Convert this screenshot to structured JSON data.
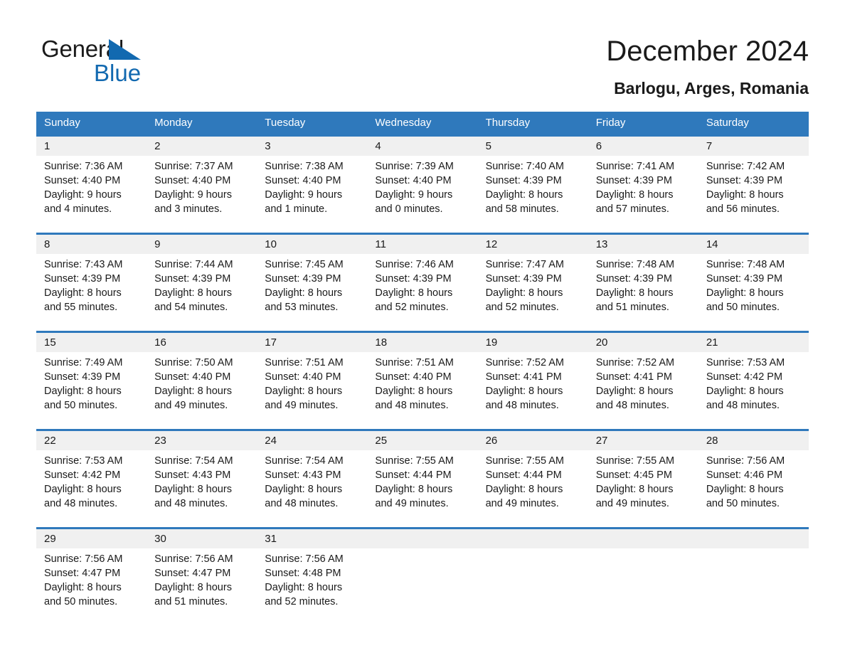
{
  "brand": {
    "word_one": "General",
    "word_two": "Blue",
    "triangle_color": "#1269b0",
    "text_color": "#1b1b1b"
  },
  "header": {
    "title": "December 2024",
    "subtitle": "Barlogu, Arges, Romania"
  },
  "theme": {
    "header_blue": "#2f79bc",
    "week_rule_blue": "#2f79bc",
    "date_band_gray": "#f0f0f0",
    "text": "#1a1a1a"
  },
  "weekdays": [
    "Sunday",
    "Monday",
    "Tuesday",
    "Wednesday",
    "Thursday",
    "Friday",
    "Saturday"
  ],
  "weeks": [
    {
      "days": [
        {
          "date": "1",
          "lines": [
            "Sunrise: 7:36 AM",
            "Sunset: 4:40 PM",
            "Daylight: 9 hours",
            "and 4 minutes."
          ]
        },
        {
          "date": "2",
          "lines": [
            "Sunrise: 7:37 AM",
            "Sunset: 4:40 PM",
            "Daylight: 9 hours",
            "and 3 minutes."
          ]
        },
        {
          "date": "3",
          "lines": [
            "Sunrise: 7:38 AM",
            "Sunset: 4:40 PM",
            "Daylight: 9 hours",
            "and 1 minute."
          ]
        },
        {
          "date": "4",
          "lines": [
            "Sunrise: 7:39 AM",
            "Sunset: 4:40 PM",
            "Daylight: 9 hours",
            "and 0 minutes."
          ]
        },
        {
          "date": "5",
          "lines": [
            "Sunrise: 7:40 AM",
            "Sunset: 4:39 PM",
            "Daylight: 8 hours",
            "and 58 minutes."
          ]
        },
        {
          "date": "6",
          "lines": [
            "Sunrise: 7:41 AM",
            "Sunset: 4:39 PM",
            "Daylight: 8 hours",
            "and 57 minutes."
          ]
        },
        {
          "date": "7",
          "lines": [
            "Sunrise: 7:42 AM",
            "Sunset: 4:39 PM",
            "Daylight: 8 hours",
            "and 56 minutes."
          ]
        }
      ]
    },
    {
      "days": [
        {
          "date": "8",
          "lines": [
            "Sunrise: 7:43 AM",
            "Sunset: 4:39 PM",
            "Daylight: 8 hours",
            "and 55 minutes."
          ]
        },
        {
          "date": "9",
          "lines": [
            "Sunrise: 7:44 AM",
            "Sunset: 4:39 PM",
            "Daylight: 8 hours",
            "and 54 minutes."
          ]
        },
        {
          "date": "10",
          "lines": [
            "Sunrise: 7:45 AM",
            "Sunset: 4:39 PM",
            "Daylight: 8 hours",
            "and 53 minutes."
          ]
        },
        {
          "date": "11",
          "lines": [
            "Sunrise: 7:46 AM",
            "Sunset: 4:39 PM",
            "Daylight: 8 hours",
            "and 52 minutes."
          ]
        },
        {
          "date": "12",
          "lines": [
            "Sunrise: 7:47 AM",
            "Sunset: 4:39 PM",
            "Daylight: 8 hours",
            "and 52 minutes."
          ]
        },
        {
          "date": "13",
          "lines": [
            "Sunrise: 7:48 AM",
            "Sunset: 4:39 PM",
            "Daylight: 8 hours",
            "and 51 minutes."
          ]
        },
        {
          "date": "14",
          "lines": [
            "Sunrise: 7:48 AM",
            "Sunset: 4:39 PM",
            "Daylight: 8 hours",
            "and 50 minutes."
          ]
        }
      ]
    },
    {
      "days": [
        {
          "date": "15",
          "lines": [
            "Sunrise: 7:49 AM",
            "Sunset: 4:39 PM",
            "Daylight: 8 hours",
            "and 50 minutes."
          ]
        },
        {
          "date": "16",
          "lines": [
            "Sunrise: 7:50 AM",
            "Sunset: 4:40 PM",
            "Daylight: 8 hours",
            "and 49 minutes."
          ]
        },
        {
          "date": "17",
          "lines": [
            "Sunrise: 7:51 AM",
            "Sunset: 4:40 PM",
            "Daylight: 8 hours",
            "and 49 minutes."
          ]
        },
        {
          "date": "18",
          "lines": [
            "Sunrise: 7:51 AM",
            "Sunset: 4:40 PM",
            "Daylight: 8 hours",
            "and 48 minutes."
          ]
        },
        {
          "date": "19",
          "lines": [
            "Sunrise: 7:52 AM",
            "Sunset: 4:41 PM",
            "Daylight: 8 hours",
            "and 48 minutes."
          ]
        },
        {
          "date": "20",
          "lines": [
            "Sunrise: 7:52 AM",
            "Sunset: 4:41 PM",
            "Daylight: 8 hours",
            "and 48 minutes."
          ]
        },
        {
          "date": "21",
          "lines": [
            "Sunrise: 7:53 AM",
            "Sunset: 4:42 PM",
            "Daylight: 8 hours",
            "and 48 minutes."
          ]
        }
      ]
    },
    {
      "days": [
        {
          "date": "22",
          "lines": [
            "Sunrise: 7:53 AM",
            "Sunset: 4:42 PM",
            "Daylight: 8 hours",
            "and 48 minutes."
          ]
        },
        {
          "date": "23",
          "lines": [
            "Sunrise: 7:54 AM",
            "Sunset: 4:43 PM",
            "Daylight: 8 hours",
            "and 48 minutes."
          ]
        },
        {
          "date": "24",
          "lines": [
            "Sunrise: 7:54 AM",
            "Sunset: 4:43 PM",
            "Daylight: 8 hours",
            "and 48 minutes."
          ]
        },
        {
          "date": "25",
          "lines": [
            "Sunrise: 7:55 AM",
            "Sunset: 4:44 PM",
            "Daylight: 8 hours",
            "and 49 minutes."
          ]
        },
        {
          "date": "26",
          "lines": [
            "Sunrise: 7:55 AM",
            "Sunset: 4:44 PM",
            "Daylight: 8 hours",
            "and 49 minutes."
          ]
        },
        {
          "date": "27",
          "lines": [
            "Sunrise: 7:55 AM",
            "Sunset: 4:45 PM",
            "Daylight: 8 hours",
            "and 49 minutes."
          ]
        },
        {
          "date": "28",
          "lines": [
            "Sunrise: 7:56 AM",
            "Sunset: 4:46 PM",
            "Daylight: 8 hours",
            "and 50 minutes."
          ]
        }
      ]
    },
    {
      "days": [
        {
          "date": "29",
          "lines": [
            "Sunrise: 7:56 AM",
            "Sunset: 4:47 PM",
            "Daylight: 8 hours",
            "and 50 minutes."
          ]
        },
        {
          "date": "30",
          "lines": [
            "Sunrise: 7:56 AM",
            "Sunset: 4:47 PM",
            "Daylight: 8 hours",
            "and 51 minutes."
          ]
        },
        {
          "date": "31",
          "lines": [
            "Sunrise: 7:56 AM",
            "Sunset: 4:48 PM",
            "Daylight: 8 hours",
            "and 52 minutes."
          ]
        },
        {
          "date": "",
          "lines": []
        },
        {
          "date": "",
          "lines": []
        },
        {
          "date": "",
          "lines": []
        },
        {
          "date": "",
          "lines": []
        }
      ]
    }
  ]
}
